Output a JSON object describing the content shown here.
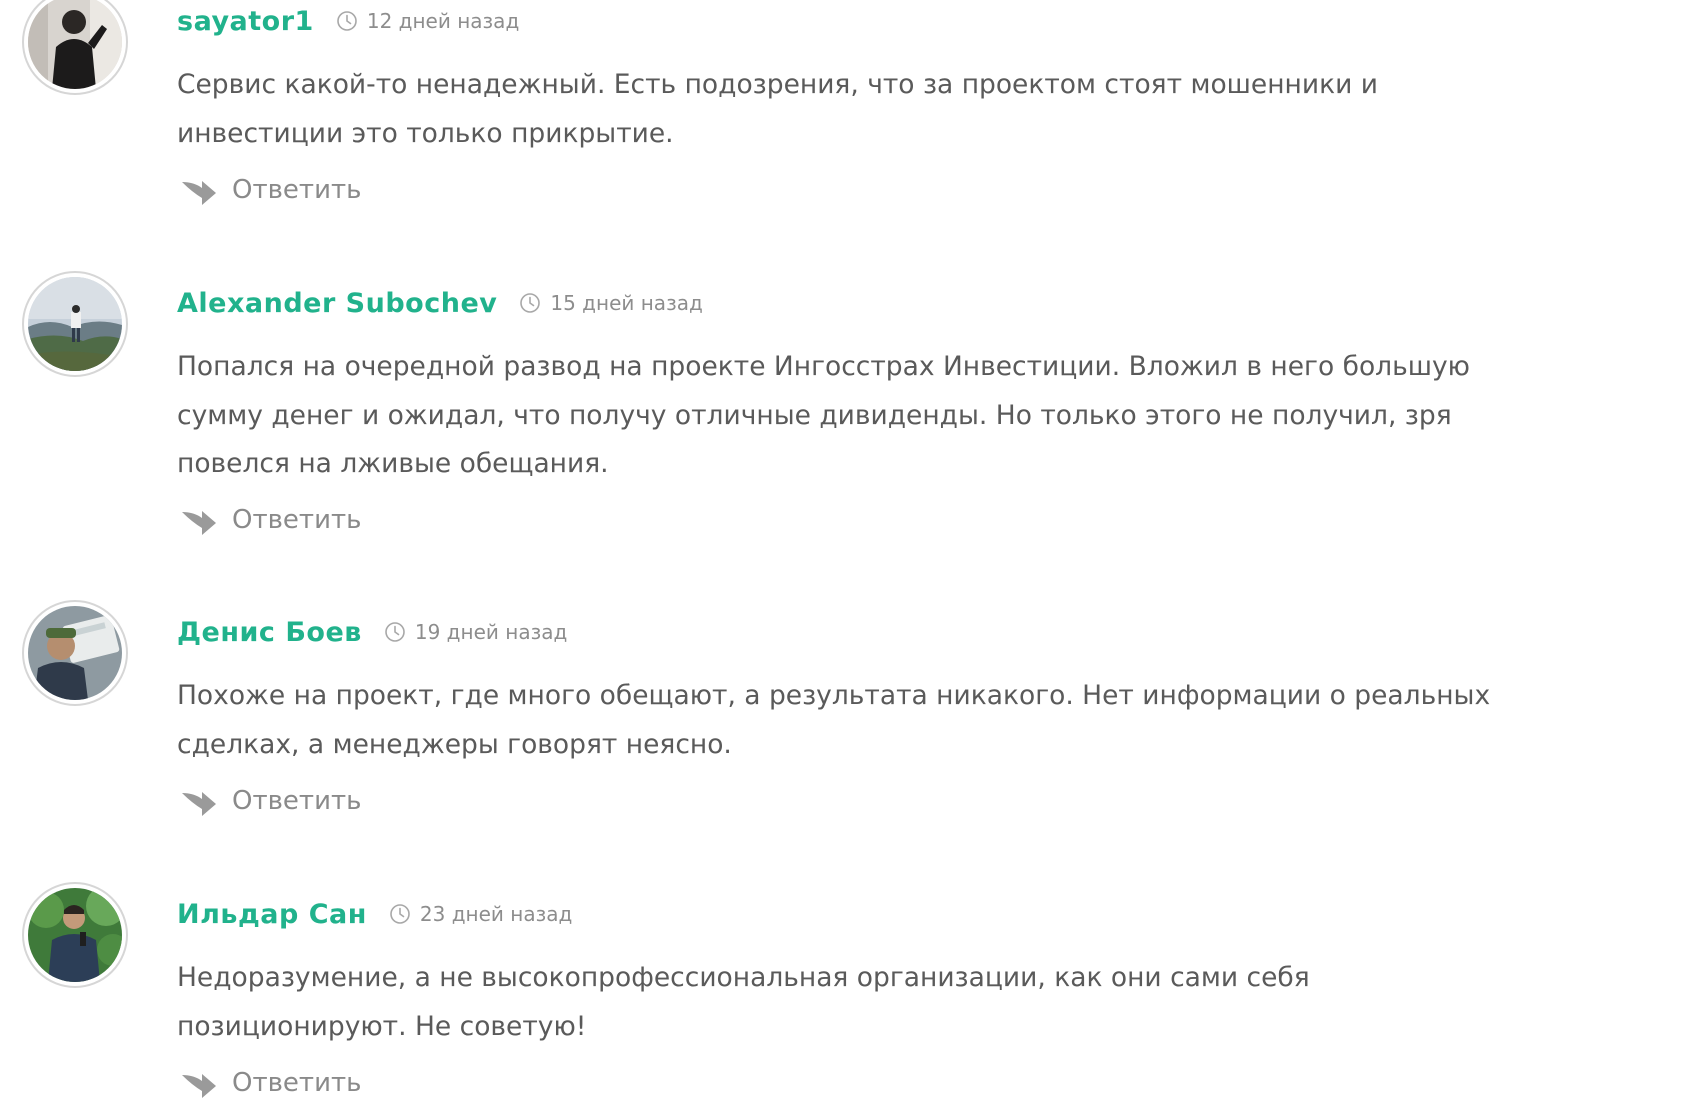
{
  "reply_label": "Ответить",
  "icons": {
    "time": "clock-icon",
    "reply": "reply-arrow-icon"
  },
  "colors": {
    "author": "#21b28c",
    "text": "#5a5a5a",
    "meta": "#8d8d8d"
  },
  "comments": [
    {
      "author": "sayator1",
      "time": "12 дней назад",
      "text": "Сервис какой-то ненадежный. Есть подозрения, что за проектом стоят мошенники и инвестиции это только прикрытие.",
      "reply": "Ответить"
    },
    {
      "author": "Alexander Subochev",
      "time": "15 дней назад",
      "text": "Попался на очередной развод на проекте Ингосстрах Инвестиции. Вложил в него большую сумму денег и ожидал, что получу отличные дивиденды. Но только этого не получил, зря повелся на лживые обещания.",
      "reply": "Ответить"
    },
    {
      "author": "Денис Боев",
      "time": "19 дней назад",
      "text": "Похоже на проект, где много обещают, а результата никакого. Нет информации о реальных сделках, а менеджеры говорят неясно.",
      "reply": "Ответить"
    },
    {
      "author": "Ильдар Сан",
      "time": "23 дней назад",
      "text": "Недоразумение, а не высокопрофессиональная организации, как они сами себя позиционируют. Не советую!",
      "reply": "Ответить"
    }
  ]
}
